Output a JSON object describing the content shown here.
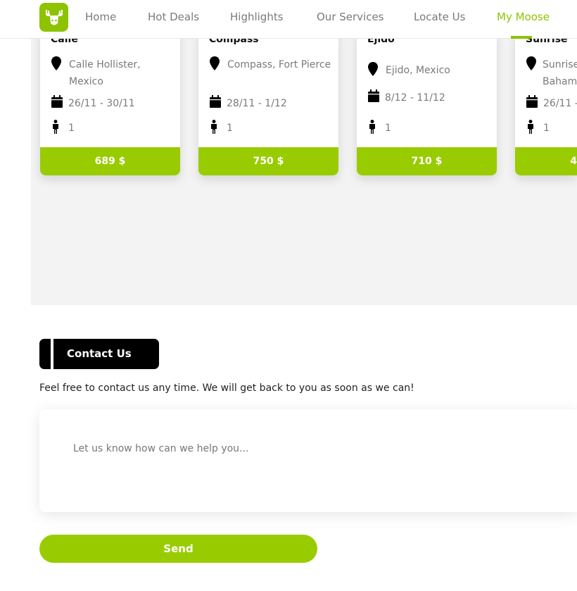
{
  "nav": {
    "logo_icon": "moose-icon",
    "items": [
      {
        "label": "Home"
      },
      {
        "label": "Hot Deals"
      },
      {
        "label": "Highlights"
      },
      {
        "label": "Our Services"
      },
      {
        "label": "Locate Us"
      },
      {
        "label": "My Moose",
        "active": true
      }
    ]
  },
  "deals": [
    {
      "title": "Calle",
      "location": "Calle Hollister, Mexico",
      "dates": "26/11 - 30/11",
      "people": "1",
      "price": "689 $"
    },
    {
      "title": "Compass",
      "location": "Compass, Fort Pierce",
      "dates": "28/11 - 1/12",
      "people": "1",
      "price": "750 $"
    },
    {
      "title": "Ejido",
      "location": "Ejido, Mexico",
      "dates": "8/12 - 11/12",
      "people": "1",
      "price": "710 $"
    },
    {
      "title": "Sunrise",
      "location": "Sunrise, Baham",
      "dates": "26/11 -",
      "people": "1",
      "price": "4"
    }
  ],
  "contact": {
    "heading": "Contact Us",
    "description": "Feel free to contact us any time. We will get back to you as soon as we can!",
    "message_placeholder": "Let us know how can we help you...",
    "send_label": "Send"
  },
  "colors": {
    "accent": "#99cc00",
    "brand": "#8dc300"
  }
}
